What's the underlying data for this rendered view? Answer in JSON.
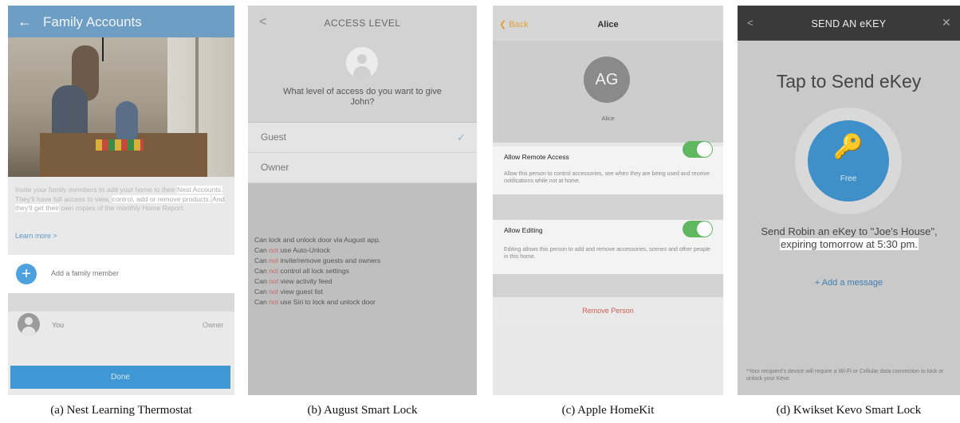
{
  "panel_a": {
    "title": "Family Accounts",
    "back_glyph": "←",
    "desc_1": "Invite your family members to add your home to their ",
    "desc_hl1": "Nest Accounts.",
    "desc_2": " They'll have full access to view, ",
    "desc_hl2": "control, add or remove products.",
    "desc_3": " ",
    "desc_hl3": "And they'll get their",
    "desc_4": " own copies of the monthly Home Report.",
    "learn_more": "Learn more >",
    "add_label": "Add a family member",
    "you_label": "You",
    "owner_label": "Owner",
    "done_label": "Done"
  },
  "panel_b": {
    "title": "ACCESS LEVEL",
    "back_glyph": "<",
    "question": "What level of access do you want to give John?",
    "options": [
      {
        "label": "Guest",
        "selected": true
      },
      {
        "label": "Owner",
        "selected": false
      }
    ],
    "check_glyph": "✓",
    "permissions": [
      {
        "neg": "",
        "text": "Can lock and unlock door via August app."
      },
      {
        "pre": "Can ",
        "neg": "not",
        "text": " use Auto-Unlock"
      },
      {
        "pre": "Can ",
        "neg": "not",
        "text": " invite/remove guests and owners"
      },
      {
        "pre": "Can ",
        "neg": "not",
        "text": " control all lock settings"
      },
      {
        "pre": "Can ",
        "neg": "not",
        "text": " view activity feed"
      },
      {
        "pre": "Can ",
        "neg": "not",
        "text": " view guest list"
      },
      {
        "pre": "Can ",
        "neg": "not",
        "text": " use Siri to lock and unlock door"
      }
    ]
  },
  "panel_c": {
    "back_label": "Back",
    "title": "Alice",
    "initials": "AG",
    "name": "Alice",
    "remote_label": "Allow Remote Access",
    "remote_desc": "Allow this person to control accessories, see when they are being used and receive notifications while not at home.",
    "editing_label": "Allow Editing",
    "editing_desc": "Editing allows this person to add and remove accessories, scenes and other people in this home.",
    "remove_label": "Remove Person"
  },
  "panel_d": {
    "title": "SEND AN eKEY",
    "back_glyph": "<",
    "close_glyph": "✕",
    "big_title": "Tap to Send eKey",
    "free_label": "Free",
    "key_glyph": "🔑",
    "msg_1": "Send Robin an eKey to \"Joe's House\",",
    "msg_hl": "expiring tomorrow at 5:30 pm.",
    "add_message": "+ Add a message",
    "footnote": "*Your recipient's device will require a Wi-Fi or Cellular data connection to lock or unlock your Kevo"
  },
  "captions": {
    "a": "(a)  Nest Learning Thermostat",
    "b": "(b)  August Smart Lock",
    "c": "(c)  Apple HomeKit",
    "d": "(d)  Kwikset Kevo Smart Lock"
  },
  "colors": {
    "nest_header": "#6e9ec4",
    "nest_button": "#3f97d3",
    "august_negative": "#c46a64",
    "homekit_toggle": "#5fb85f",
    "homekit_back": "#e0a33a",
    "homekit_remove": "#cf5e52",
    "kevo_header": "#3a3a3a",
    "kevo_circle": "#3f90c9"
  }
}
